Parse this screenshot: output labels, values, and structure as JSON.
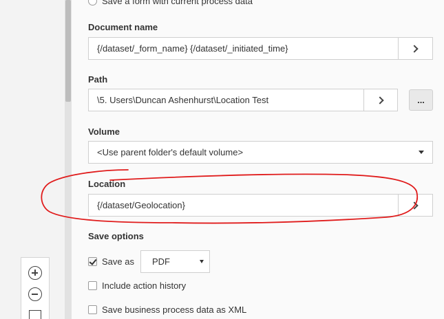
{
  "top_option": {
    "label": "Save a form with current process data",
    "selected": false
  },
  "document_name": {
    "label": "Document name",
    "value": "{/dataset/_form_name} {/dataset/_initiated_time}"
  },
  "path": {
    "label": "Path",
    "value": "\\5. Users\\Duncan Ashenhurst\\Location Test",
    "browse_label": "..."
  },
  "volume": {
    "label": "Volume",
    "value": "<Use parent folder's default volume>"
  },
  "location": {
    "label": "Location",
    "value": "{/dataset/Geolocation}"
  },
  "save_options": {
    "label": "Save options",
    "save_as": {
      "label": "Save as",
      "checked": true,
      "format": "PDF"
    },
    "include_action_history": {
      "label": "Include action history",
      "checked": false
    },
    "save_bp_xml": {
      "label": "Save business process data as XML",
      "checked": false
    }
  },
  "zoom": {
    "zoom_in": "zoom-in-icon",
    "zoom_out": "zoom-out-icon",
    "fit": "fit-to-screen-icon"
  },
  "annotation_color": "#e01b1b"
}
